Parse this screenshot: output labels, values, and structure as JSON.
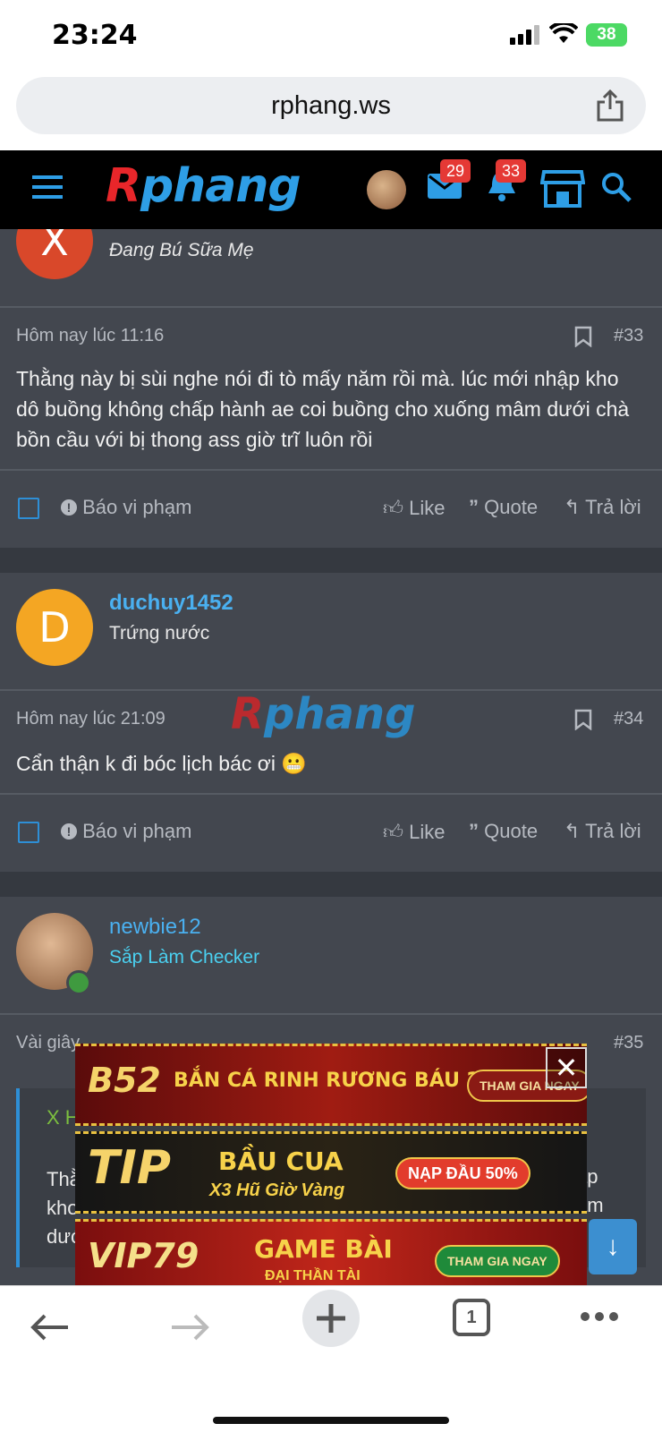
{
  "status_bar": {
    "time": "23:24",
    "battery": "38"
  },
  "browser": {
    "url": "rphang.ws",
    "tab_count": "1"
  },
  "site": {
    "logo_r": "R",
    "logo_rest": "phang",
    "mail_badge": "29",
    "bell_badge": "33"
  },
  "posts": [
    {
      "user_title": "Đang Bú Sữa Mẹ",
      "avatar_letter": "X",
      "avatar_color": "#d9482a",
      "time": "Hôm nay lúc 11:16",
      "number": "#33",
      "text": "Thằng này bị sùi nghe nói đi tò mấy năm rồi mà. lúc mới nhập kho dô buồng không chấp hành ae coi buồng cho xuống mâm dưới chà bồn cầu với bị thong ass giờ trĩ luôn rồi"
    },
    {
      "username": "duchuy1452",
      "user_title": "Trứng nước",
      "avatar_letter": "D",
      "avatar_color": "#f4a623",
      "time": "Hôm nay lúc 21:09",
      "number": "#34",
      "text": "Cẩn thận k đi bóc lịch bác ơi 😬"
    },
    {
      "username": "newbie12",
      "user_title": "Sắp Làm Checker",
      "time": "Vài giây",
      "number": "#35",
      "quote_author": "X H",
      "quote_text_left": "Thằ",
      "quote_text_left2": "kho",
      "quote_text_left3": "dướ",
      "quote_text_right": "ập",
      "quote_text_right2": "âm"
    }
  ],
  "actions": {
    "report": "Báo vi phạm",
    "like": "Like",
    "quote": "Quote",
    "reply": "Trả lời"
  },
  "ads": [
    {
      "brand": "B52",
      "title": "BẮN CÁ RINH  RƯƠNG BÁU 2,5M",
      "cta": "THAM GIA NGAY"
    },
    {
      "brand": "TIP",
      "title": "BẦU CUA",
      "subtitle": "X3 Hũ Giờ Vàng",
      "cta": "NẠP ĐẦU 50%"
    },
    {
      "brand": "VIP79",
      "title": "GAME BÀI",
      "subtitle": "ĐẠI THẦN TÀI",
      "cta": "THAM GIA NGAY"
    }
  ],
  "colors": {
    "accent": "#2e8fd6",
    "username": "#4ab0f0",
    "checker_title": "#4ad0f0",
    "background": "#43474f"
  }
}
